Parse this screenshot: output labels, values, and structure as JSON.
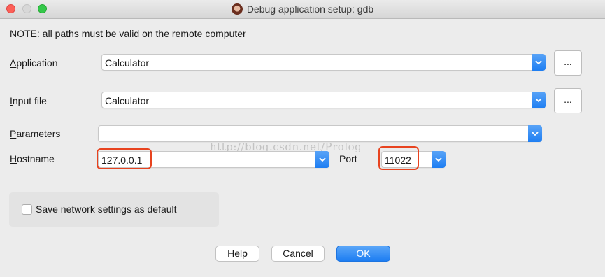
{
  "window": {
    "title": "Debug application setup: gdb"
  },
  "note": "NOTE: all paths must be valid on the remote computer",
  "fields": {
    "application": {
      "label_first": "A",
      "label_rest": "pplication",
      "value": "Calculator",
      "browse_label": "..."
    },
    "input_file": {
      "label_first": "I",
      "label_rest": "nput file",
      "value": "Calculator",
      "browse_label": "..."
    },
    "parameters": {
      "label_first": "P",
      "label_rest": "arameters",
      "value": ""
    },
    "hostname": {
      "label_first": "H",
      "label_rest": "ostname",
      "value": "127.0.0.1"
    },
    "port": {
      "label": "Port",
      "value": "11022"
    }
  },
  "save_settings": {
    "label": "Save network settings as default",
    "checked": false
  },
  "buttons": {
    "help": "Help",
    "cancel": "Cancel",
    "ok": "OK"
  },
  "watermark": "http://blog.csdn.net/Prolog",
  "colors": {
    "accent": "#1e7ef2",
    "highlight": "#e8431f"
  }
}
